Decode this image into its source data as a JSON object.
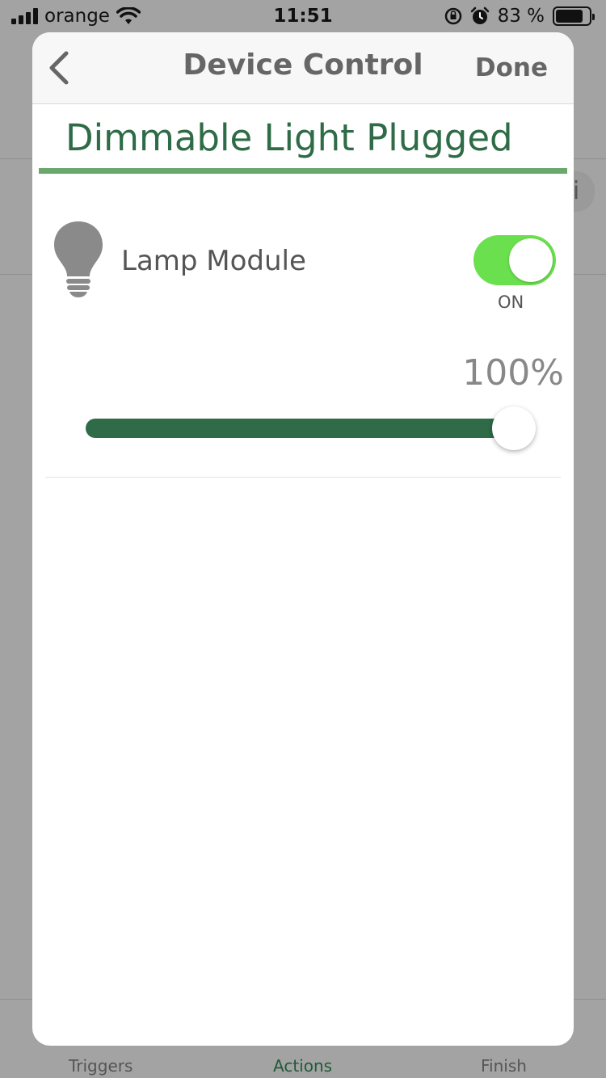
{
  "status_bar": {
    "carrier": "orange",
    "time": "11:51",
    "battery_percent": "83 %",
    "battery_level": 0.83
  },
  "background": {
    "tabs": [
      {
        "label": "Triggers"
      },
      {
        "label": "Actions"
      },
      {
        "label": "Finish"
      }
    ],
    "info_glyph": "i"
  },
  "modal": {
    "title": "Device Control",
    "done_label": "Done",
    "device_name": "Dimmable Light Plugged",
    "device": {
      "label": "Lamp Module",
      "icon": "lightbulb-icon",
      "toggle_state": "ON",
      "toggle_on": true,
      "toggle_color": "#6be04e"
    },
    "dimmer": {
      "value_label": "100%",
      "value": 100
    },
    "accent_color": "#2e6b46"
  }
}
